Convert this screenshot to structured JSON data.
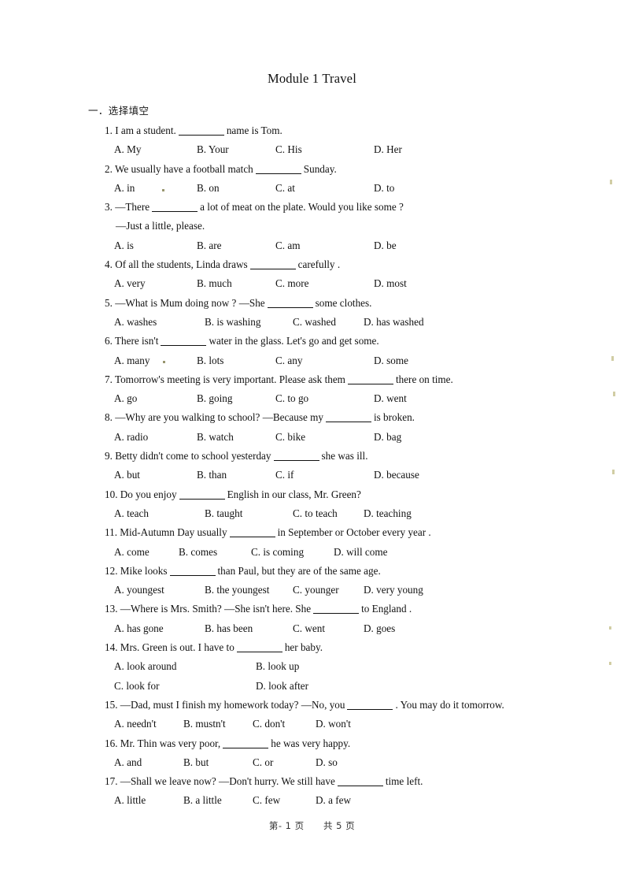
{
  "document": {
    "title": "Module 1 Travel",
    "section_heading": "一．选择填空"
  },
  "questions": [
    {
      "number": "1.",
      "stem_before": "I am a student.",
      "stem_after": "name is Tom.",
      "layout": "cols4",
      "options": [
        "A. My",
        "B. Your",
        "C. His",
        "D. Her"
      ]
    },
    {
      "number": "2.",
      "stem_before": "We usually have a football match",
      "stem_after": "Sunday.",
      "layout": "cols4",
      "options": [
        "A. in",
        "B. on",
        "C. at",
        "D. to"
      ]
    },
    {
      "number": "3.",
      "stem_before": "—There",
      "stem_after": "a lot of meat on the plate. Would you like some ?",
      "continuation": "—Just a little, please.",
      "layout": "cols4",
      "options": [
        "A. is",
        "B. are",
        "C. am",
        "D. be"
      ]
    },
    {
      "number": "4.",
      "stem_before": "Of all the students, Linda draws",
      "stem_after": "carefully .",
      "layout": "cols4",
      "options": [
        "A. very",
        "B. much",
        "C. more",
        "D. most"
      ]
    },
    {
      "number": "5.",
      "stem_before": "—What is Mum doing now ? —She",
      "stem_after": "some clothes.",
      "layout": "cols4m",
      "options": [
        "A. washes",
        "B. is washing",
        "C. washed",
        "D. has washed"
      ]
    },
    {
      "number": "6.",
      "stem_before": "There isn't",
      "stem_after": "water in the glass. Let's go and get some.",
      "layout": "cols4",
      "options": [
        "A. many",
        "B. lots",
        "C. any",
        "D. some"
      ]
    },
    {
      "number": "7.",
      "stem_before": "Tomorrow's meeting is very important. Please ask them",
      "stem_after": "there on time.",
      "layout": "cols4",
      "options": [
        "A. go",
        "B. going",
        "C. to go",
        "D. went"
      ]
    },
    {
      "number": "8.",
      "stem_before": "—Why are you walking to school? —Because my",
      "stem_after": "is broken.",
      "layout": "cols4",
      "options": [
        "A. radio",
        "B. watch",
        "C. bike",
        "D. bag"
      ]
    },
    {
      "number": "9.",
      "stem_before": "Betty didn't come to school yesterday",
      "stem_after": "she was ill.",
      "layout": "cols4",
      "options": [
        "A. but",
        "B. than",
        "C. if",
        "D. because"
      ]
    },
    {
      "number": "10.",
      "stem_before": "Do you enjoy",
      "stem_after": "English in our class, Mr. Green?",
      "layout": "cols4m",
      "options": [
        "A. teach",
        "B. taught",
        "C. to teach",
        "D. teaching"
      ]
    },
    {
      "number": "11.",
      "stem_before": "Mid-Autumn Day usually",
      "stem_after": "in September or October every year .",
      "layout": "cols4t",
      "options": [
        "A. come",
        "B. comes",
        "C. is coming",
        "D. will come"
      ]
    },
    {
      "number": "12.",
      "stem_before": "Mike looks",
      "stem_after": "than Paul, but they are of the same age.",
      "layout": "cols4m",
      "options": [
        "A. youngest",
        "B. the youngest",
        "C. younger",
        "D. very young"
      ]
    },
    {
      "number": "13.",
      "stem_before": "—Where is Mrs. Smith? —She isn't here. She",
      "stem_after": "to England .",
      "layout": "cols4m",
      "options": [
        "A. has gone",
        "B. has been",
        "C. went",
        "D. goes"
      ]
    },
    {
      "number": "14.",
      "stem_before": "Mrs. Green is out. I have to",
      "stem_after": "her baby.",
      "layout": "cols2",
      "options": [
        "A. look around",
        "B. look up",
        "C. look for",
        "D. look after"
      ]
    },
    {
      "number": "15.",
      "stem_before": "—Dad, must I finish my homework today? —No, you",
      "stem_after": ". You may do it tomorrow.",
      "layout": "cols4n",
      "options": [
        "A. needn't",
        "B. mustn't",
        "C. don't",
        "D. won't"
      ]
    },
    {
      "number": "16.",
      "stem_before": "Mr. Thin was very poor,",
      "stem_after": "he was very happy.",
      "layout": "cols4n",
      "options": [
        "A. and",
        "B. but",
        "C. or",
        "D. so"
      ]
    },
    {
      "number": "17.",
      "stem_before": "—Shall we leave now? —Don't hurry. We still have",
      "stem_after": "time left.",
      "layout": "cols4n",
      "options": [
        "A. little",
        "B. a little",
        "C. few",
        "D. a few"
      ]
    }
  ],
  "footer": {
    "page_label": "第- 1 页",
    "total_label": "共 5 页"
  }
}
